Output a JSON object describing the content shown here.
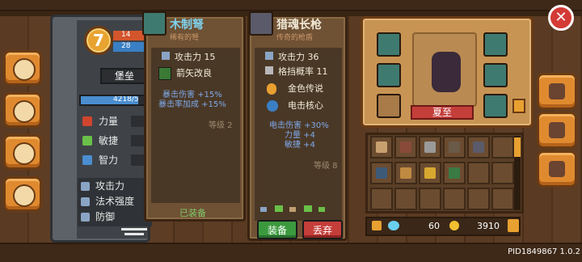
{
  "level": "7",
  "hp_text": "14",
  "mp_text": "28",
  "character_name": "堡垒",
  "xp": {
    "text": "4218/5",
    "fraction": 0.85
  },
  "attributes": [
    {
      "label": "力量",
      "color": "#d0452e"
    },
    {
      "label": "敏捷",
      "color": "#6ac048"
    },
    {
      "label": "智力",
      "color": "#4a8ed0"
    }
  ],
  "stats": [
    "攻击力",
    "法术强度",
    "防御"
  ],
  "crossbow_card": {
    "name": "木制弩",
    "rarity": "稀有的弩",
    "attack": "攻击力 15",
    "perk": "箭矢改良",
    "bonus1": "暴击伤害 +15%",
    "bonus2": "暴击率加成 +15%",
    "level": "等级 2",
    "status": "已装备",
    "name_color": "#7fd3f0"
  },
  "spear_card": {
    "name": "猎魂长枪",
    "rarity": "传奇的枪盾",
    "attack": "攻击力 36",
    "block": "格挡概率 11",
    "gem1": "金色传说",
    "gem2": "电击核心",
    "bonus1": "电击伤害 +30%",
    "bonus2": "力量 +4",
    "bonus3": "敏捷 +4",
    "level": "等级 8",
    "equip_label": "装备",
    "discard_label": "丢弃"
  },
  "equipment": {
    "hero_name": "夏至"
  },
  "currency": {
    "gems": "60",
    "gold": "3910"
  },
  "version": "PID1849867 1.0.2",
  "icons": {
    "close": "close-icon",
    "equip_tab": "helmet-icon",
    "craft_tab": "hammer-icon",
    "settings_tab": "gear-icon"
  }
}
